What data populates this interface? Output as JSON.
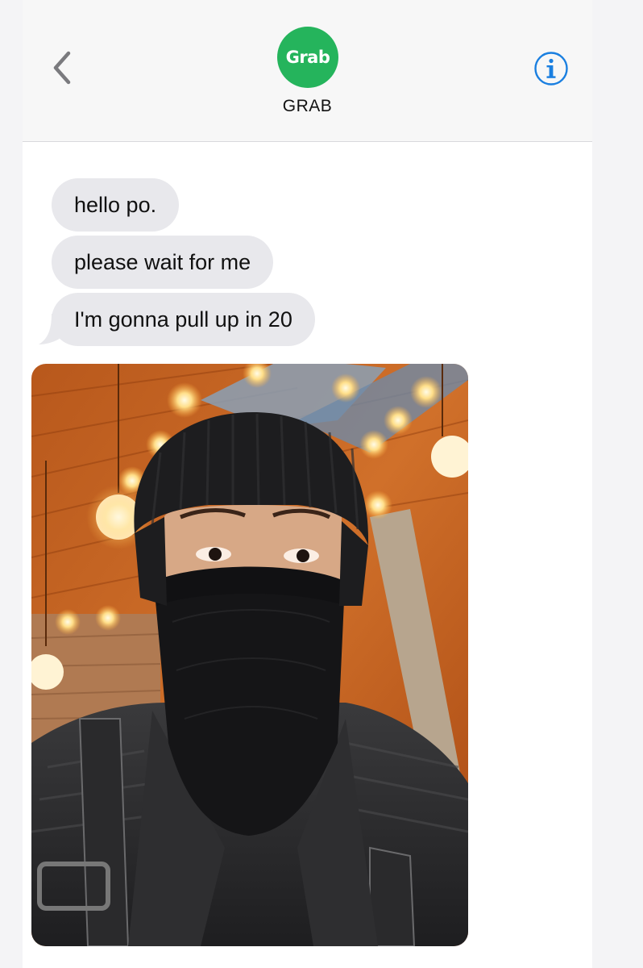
{
  "header": {
    "contact_name": "GRAB",
    "avatar_text": "Grab",
    "back_icon": "chevron-left-icon",
    "info_icon": "info-circle-icon"
  },
  "messages": [
    {
      "text": "hello po."
    },
    {
      "text": "please wait for me"
    },
    {
      "text": "I'm gonna pull up in 20"
    }
  ],
  "colors": {
    "brand": "#25b45c",
    "accent": "#1a7fe0",
    "bubble_incoming": "#e8e8ec"
  }
}
